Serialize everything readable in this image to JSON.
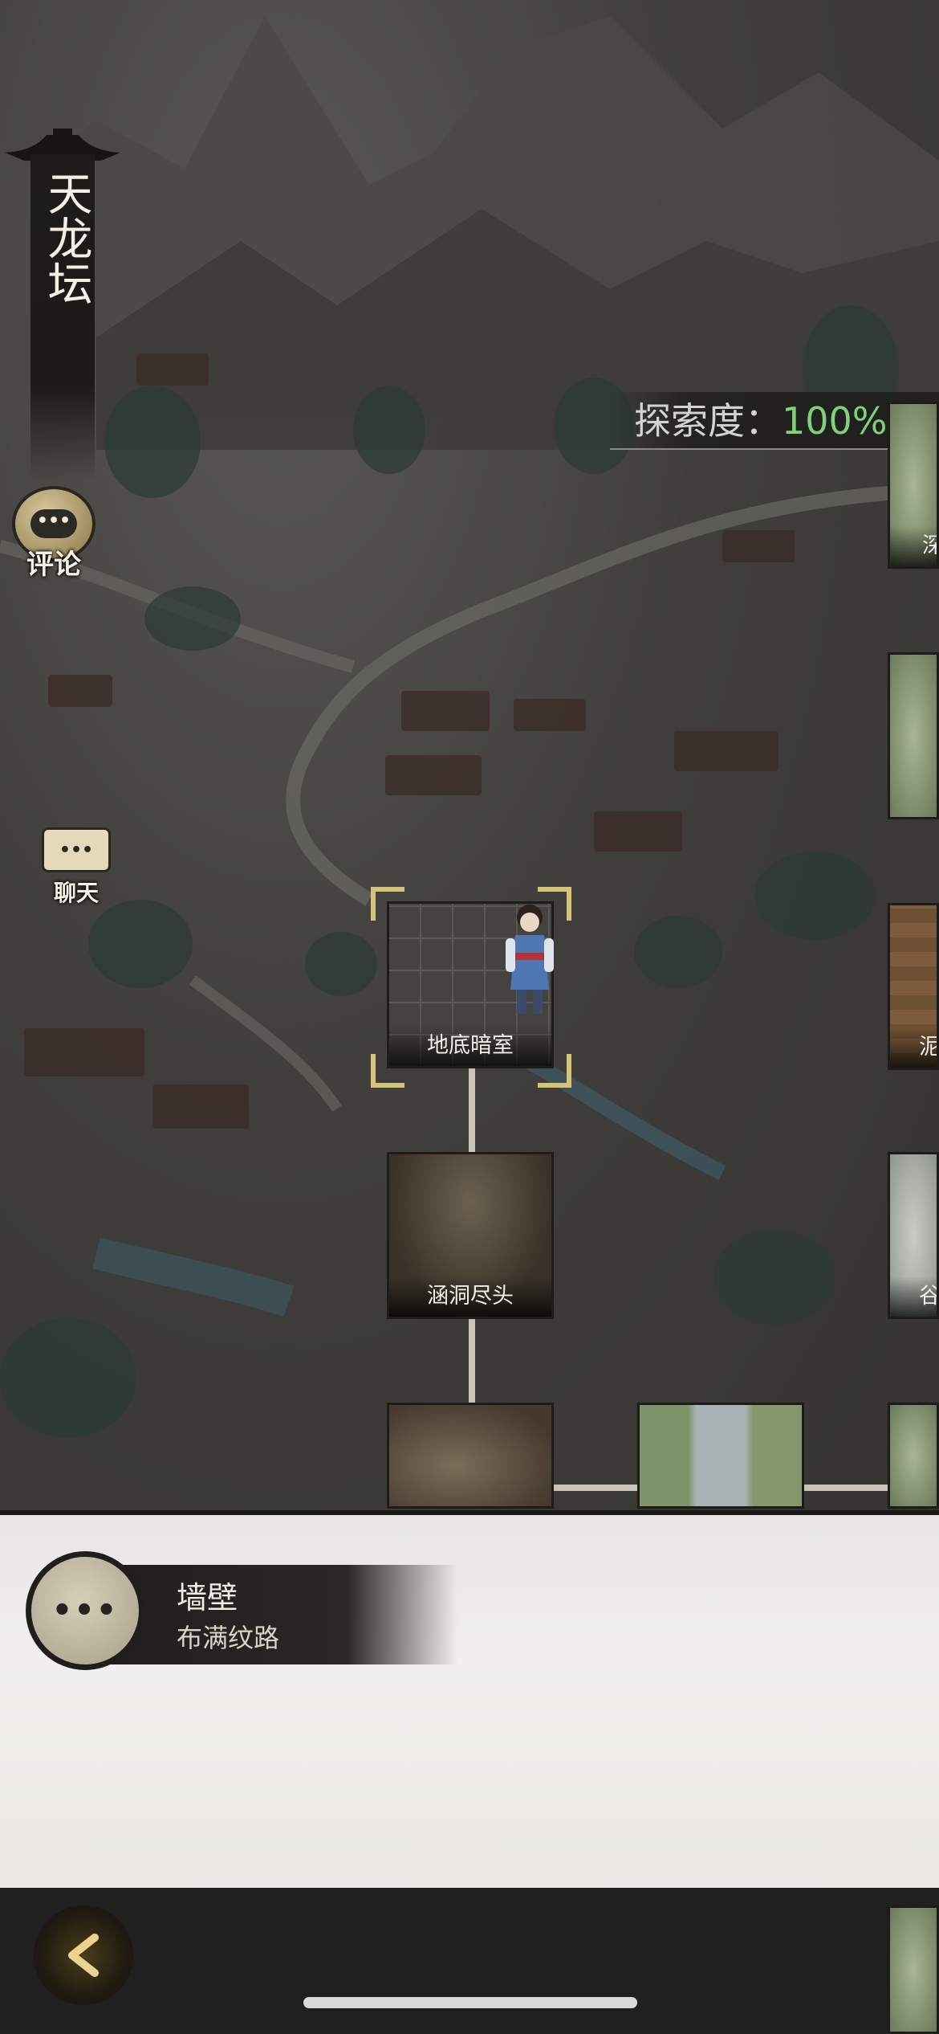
{
  "location": {
    "name": "天龙坛"
  },
  "sidebar": {
    "comment_icon_text": "•••",
    "comment_label": "评论",
    "chat_icon_text": "•••",
    "chat_label": "聊天"
  },
  "exploration": {
    "label": "探索度：",
    "value": "100%"
  },
  "map_tiles": {
    "current": "地底暗室",
    "below_1": "涵洞尽头",
    "right_1": "深",
    "right_3": "泥",
    "right_4": "谷"
  },
  "info_panel": {
    "icon_text": "•••",
    "title": "墙壁",
    "description": "布满纹路"
  },
  "colors": {
    "explore_value": "#7fd178",
    "selection_frame": "#d6c37a",
    "panel_bg": "#f1f0ec",
    "bar_bg": "#202020"
  }
}
